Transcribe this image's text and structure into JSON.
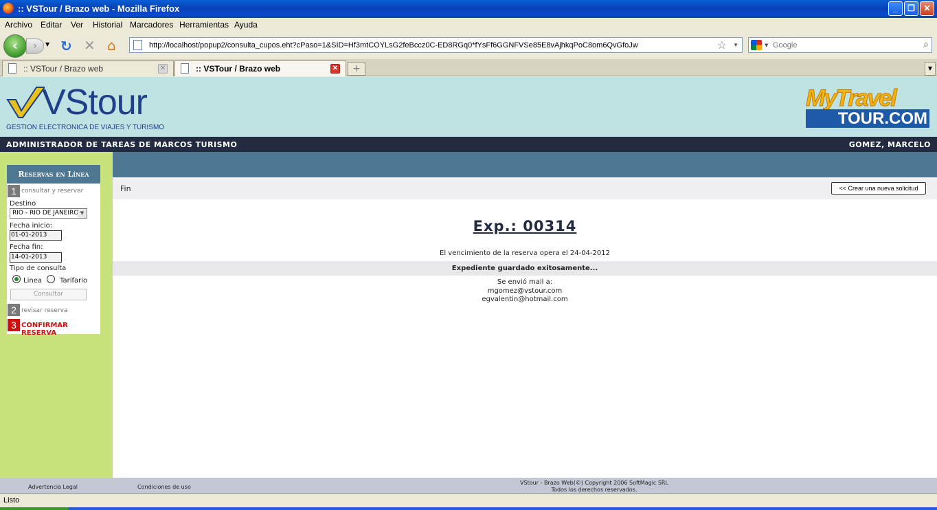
{
  "window": {
    "title": ":: VSTour / Brazo web - Mozilla Firefox"
  },
  "menu": {
    "items": [
      "Archivo",
      "Editar",
      "Ver",
      "Historial",
      "Marcadores",
      "Herramientas",
      "Ayuda"
    ]
  },
  "nav": {
    "url": "http://localhost/popup2/consulta_cupos.eht?cPaso=1&SID=Hf3mtCOYLsG2feBccz0C-ED8RGq0*fYsFf6GGNFVSe85E8vAjhkqPoC8om6QvGfoJw",
    "search_placeholder": "Google"
  },
  "tabs": [
    {
      "label": ":: VSTour / Brazo web",
      "active": false
    },
    {
      "label": ":: VSTour / Brazo web",
      "active": true
    }
  ],
  "banner": {
    "logo_name": "VStour",
    "logo_sub": "GESTION ELECTRONICA DE VIAJES Y TURISMO",
    "partner_top": "MyTravel",
    "partner_bottom": "TOUR.COM"
  },
  "admin": {
    "left": "ADMINISTRADOR DE TAREAS DE MARCOS TURISMO",
    "right": "GOMEZ, MARCELO"
  },
  "sidebar": {
    "title": "Reservas en Línea",
    "step1": {
      "num": "1",
      "label": "consultar y reservar"
    },
    "destino_label": "Destino",
    "destino_value": "RIO - RIO DE JANEIRO",
    "fecha_inicio_label": "Fecha inicio:",
    "fecha_inicio_value": "01-01-2013",
    "fecha_fin_label": "Fecha fin:",
    "fecha_fin_value": "14-01-2013",
    "tipo_label": "Tipo de consulta",
    "radio_linea": "Linea",
    "radio_tarifario": "Tarifario",
    "consultar_label": "Consultar",
    "step2": {
      "num": "2",
      "label": "revisar reserva"
    },
    "step3": {
      "num": "3",
      "label": "CONFIRMAR RESERVA"
    }
  },
  "content": {
    "breadcrumb": "Fin",
    "new_request_label": "<< Crear una nueva solicitud",
    "exp_title": "Exp.: 00314",
    "vencimiento": "El vencimiento de la reserva opera el 24-04-2012",
    "success": "Expediente guardado exitosamente...",
    "mail_intro": "Se envió mail a:",
    "mail_1": "mgomez@vstour.com",
    "mail_2": "egvalentin@hotmail.com"
  },
  "footer": {
    "legal": "Advertencia Legal",
    "conditions": "Condiciones de uso",
    "copyright_1": "VStour - Brazo Web(©) Copyright 2006 SoftMagic SRL",
    "copyright_2": "Todos los derechos reservados."
  },
  "status": {
    "text": "Listo"
  },
  "colors": {
    "banner": "#bfe2e2",
    "admin_bar": "#232b40",
    "sidebar": "#c8e27c",
    "steel": "#4e7791",
    "confirm_red": "#cc1111"
  }
}
